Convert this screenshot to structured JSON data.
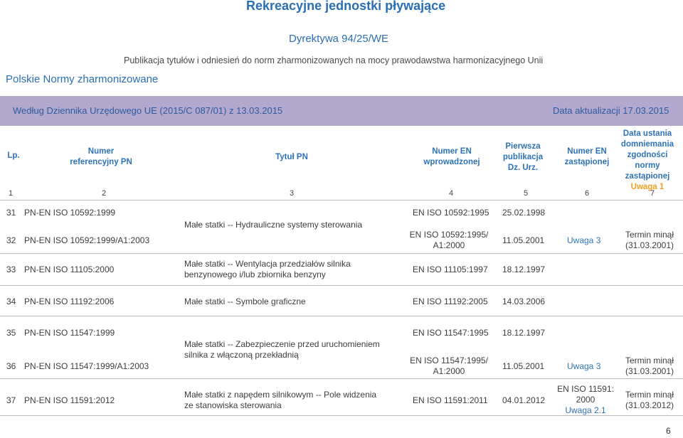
{
  "titles": {
    "main": "Rekreacyjne jednostki pływające",
    "directive": "Dyrektywa 94/25/WE",
    "publication": "Publikacja tytułów i odniesień do norm zharmonizowanych na mocy prawodawstwa harmonizacyjnego Unii",
    "polish_norms": "Polskie Normy zharmonizowane"
  },
  "journal_bar": {
    "left": "Według Dziennika Urzędowego UE (2015/C 087/01) z 13.03.2015",
    "right": "Data aktualizacji 17.03.2015"
  },
  "headers": {
    "lp": "Lp.",
    "ref_line1": "Numer",
    "ref_line2": "referencyjny PN",
    "title": "Tytuł PN",
    "en_line1": "Numer EN",
    "en_line2": "wprowadzonej",
    "first_line1": "Pierwsza",
    "first_line2": "publikacja",
    "first_line3": "Dz. Urz.",
    "replaced_line1": "Numer EN",
    "replaced_line2": "zastąpionej",
    "date_line1": "Data ustania",
    "date_line2": "domniemania",
    "date_line3": "zgodności",
    "date_line4": "normy",
    "date_line5": "zastąpionej",
    "date_line6": "Uwaga 1"
  },
  "column_numbers": [
    "1",
    "2",
    "3",
    "4",
    "5",
    "6",
    "7"
  ],
  "rows": {
    "r31": {
      "lp": "31",
      "ref": "PN-EN ISO 10592:1999",
      "en": "EN ISO 10592:1995",
      "date": "25.02.1998"
    },
    "title_hydraulic": "Małe statki -- Hydrauliczne systemy sterowania",
    "r32": {
      "lp": "32",
      "ref": "PN-EN ISO 10592:1999/A1:2003",
      "en_line1": "EN ISO 10592:1995/",
      "en_line2": "A1:2000",
      "date": "11.05.2001",
      "replaced": "Uwaga 3",
      "expiry_line1": "Termin minął",
      "expiry_line2": "(31.03.2001)"
    },
    "r33": {
      "lp": "33",
      "ref": "PN-EN ISO 11105:2000",
      "title_line1": "Małe statki -- Wentylacja przedziałów silnika",
      "title_line2": "benzynowego i/lub zbiornika benzyny",
      "en": "EN ISO 11105:1997",
      "date": "18.12.1997"
    },
    "r34": {
      "lp": "34",
      "ref": "PN-EN ISO 11192:2006",
      "title": "Małe statki -- Symbole graficzne",
      "en": "EN ISO 11192:2005",
      "date": "14.03.2006"
    },
    "r35": {
      "lp": "35",
      "ref": "PN-EN ISO 11547:1999",
      "en": "EN ISO 11547:1995",
      "date": "18.12.1997"
    },
    "title_start": {
      "line1": "Małe statki -- Zabezpieczenie przed uruchomieniem",
      "line2": "silnika z włączoną przekładnią"
    },
    "r36": {
      "lp": "36",
      "ref": "PN-EN ISO 11547:1999/A1:2003",
      "en_line1": "EN ISO 11547:1995/",
      "en_line2": "A1:2000",
      "date": "11.05.2001",
      "replaced": "Uwaga 3",
      "expiry_line1": "Termin minął",
      "expiry_line2": "(31.03.2001)"
    },
    "r37": {
      "lp": "37",
      "ref": "PN-EN ISO 11591:2012",
      "title_line1": "Małe statki z napędem silnikowym -- Pole widzenia",
      "title_line2": "ze stanowiska sterowania",
      "en": "EN ISO 11591:2011",
      "date": "04.01.2012",
      "replaced_line1": "EN ISO 11591:",
      "replaced_line2": "2000",
      "replaced_line3": "Uwaga 2.1",
      "expiry_line1": "Termin minął",
      "expiry_line2": "(31.03.2012)"
    }
  },
  "page_number": "6",
  "colors": {
    "heading_blue": "#2a6fb5",
    "bar_purple": "#b3a9cf",
    "note_orange": "#f0a020"
  }
}
